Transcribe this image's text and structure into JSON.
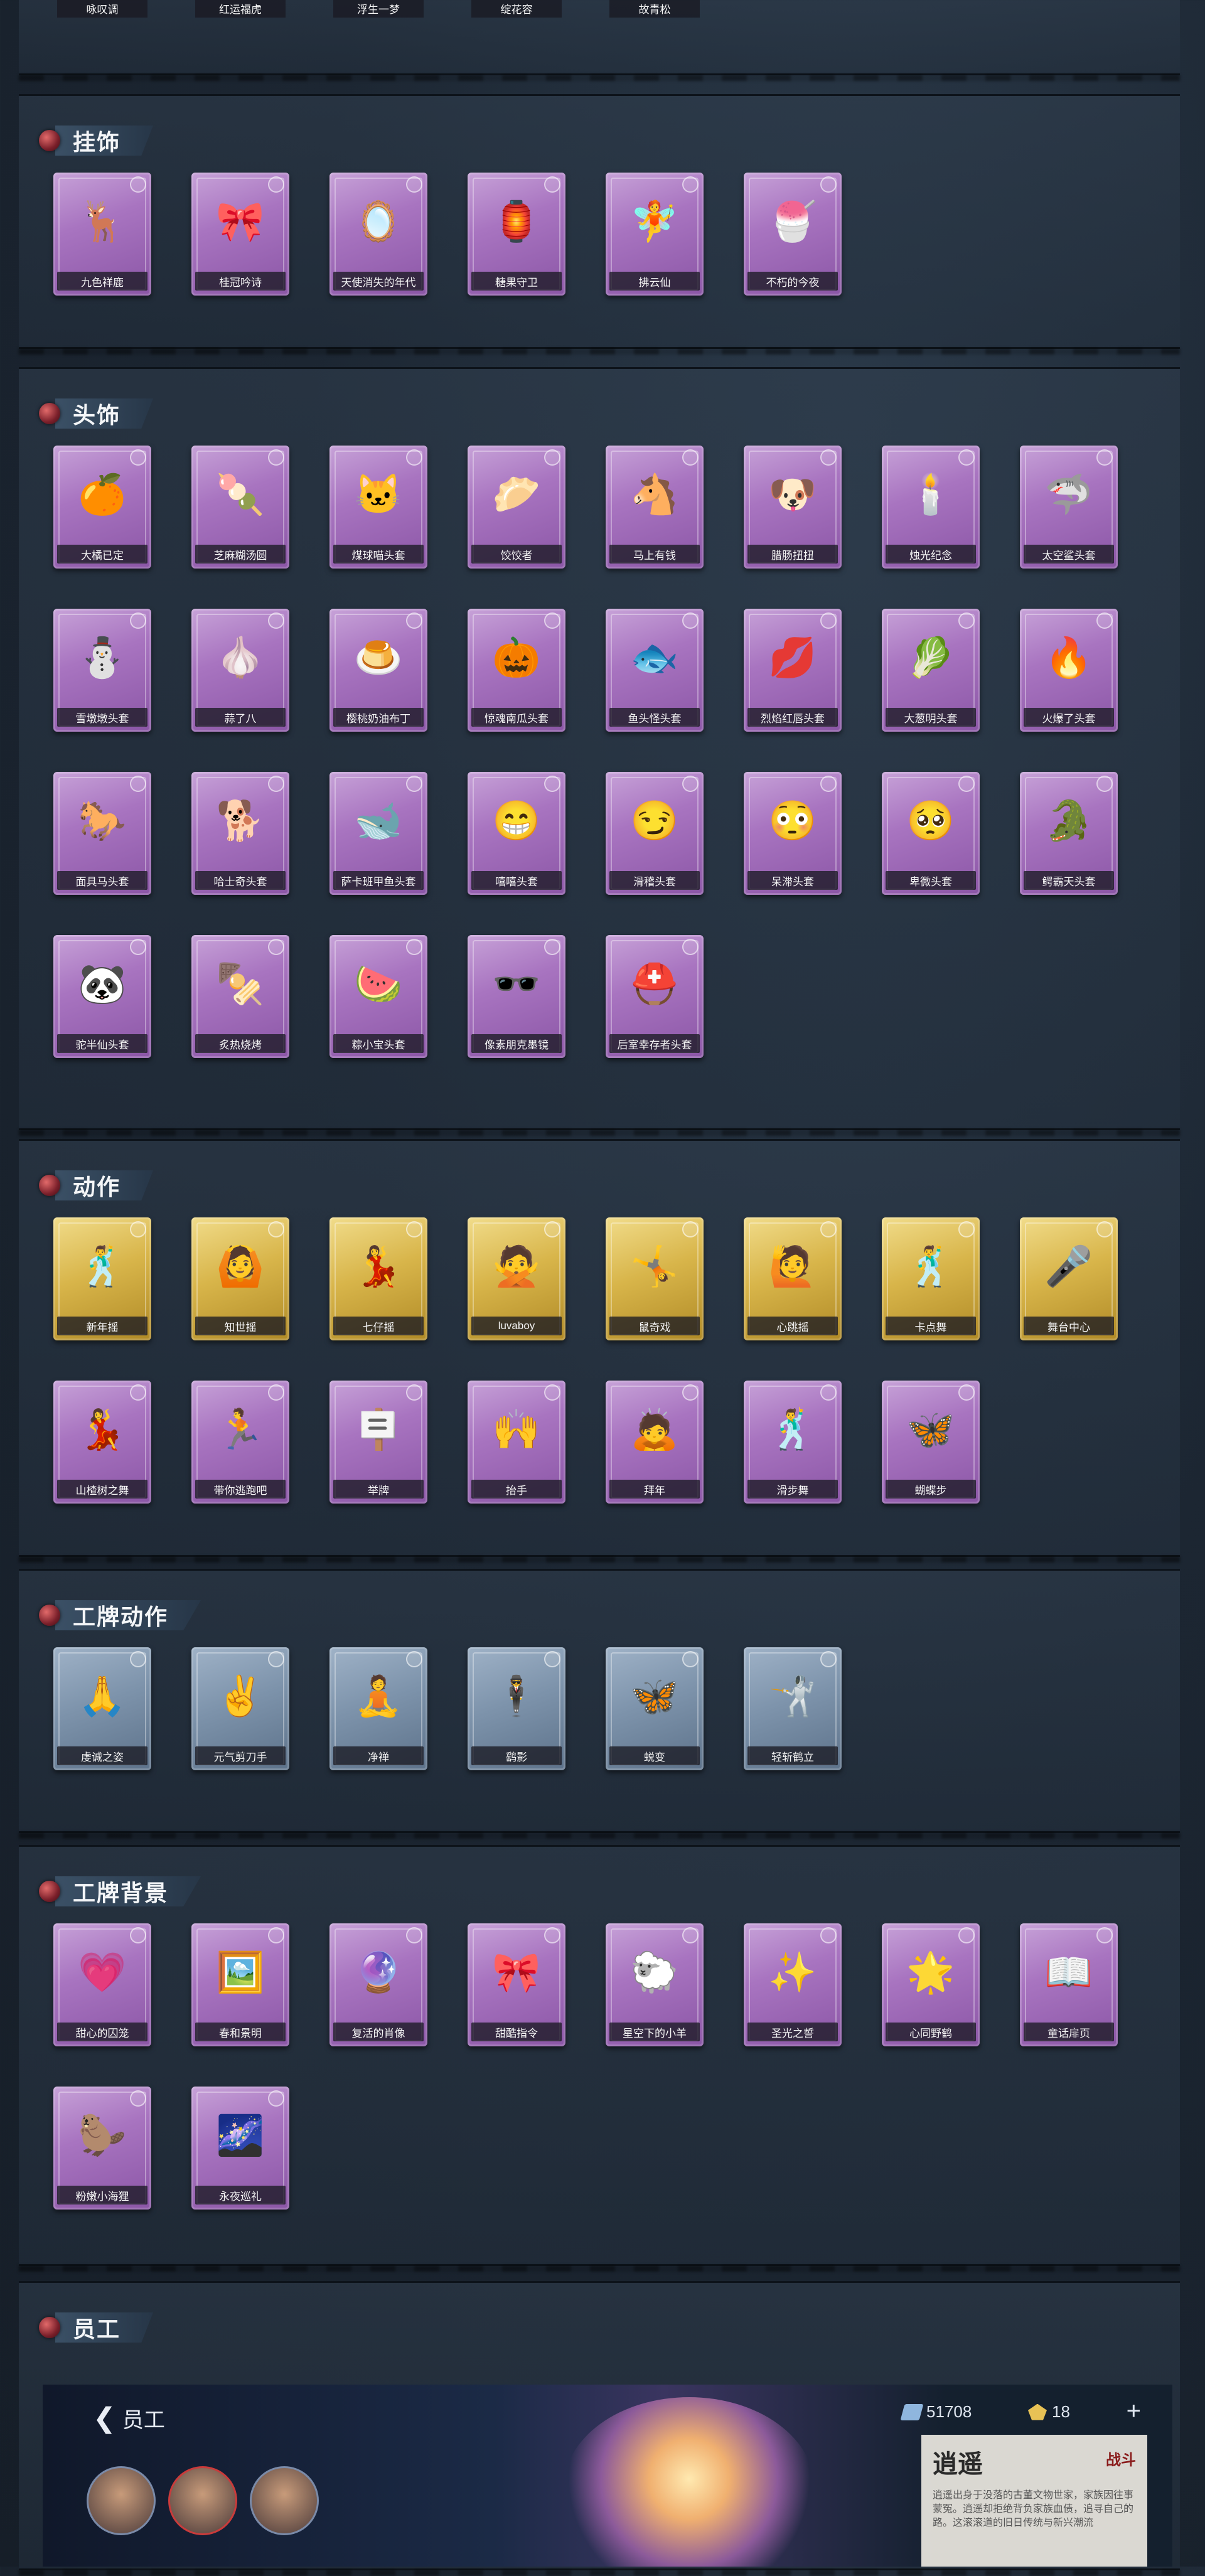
{
  "top_row": [
    "咏叹调",
    "红运福虎",
    "浮生一梦",
    "绽花容",
    "故青松"
  ],
  "sections": [
    {
      "title": "挂饰",
      "style": "purple",
      "items": [
        {
          "label": "九色祥鹿",
          "icon": "🦌"
        },
        {
          "label": "桂冠吟诗",
          "icon": "🎀"
        },
        {
          "label": "天使消失的年代",
          "icon": "🪞"
        },
        {
          "label": "糖果守卫",
          "icon": "🏮"
        },
        {
          "label": "拂云仙",
          "icon": "🧚"
        },
        {
          "label": "不朽的今夜",
          "icon": "🍧"
        }
      ]
    },
    {
      "title": "头饰",
      "style": "purple",
      "items": [
        {
          "label": "大橘已定",
          "icon": "🍊"
        },
        {
          "label": "芝麻糊汤圆",
          "icon": "🍡"
        },
        {
          "label": "煤球喵头套",
          "icon": "🐱"
        },
        {
          "label": "饺饺者",
          "icon": "🥟"
        },
        {
          "label": "马上有钱",
          "icon": "🐴"
        },
        {
          "label": "腊肠扭扭",
          "icon": "🐶"
        },
        {
          "label": "烛光纪念",
          "icon": "🕯️"
        },
        {
          "label": "太空鲨头套",
          "icon": "🦈"
        },
        {
          "label": "雪墩墩头套",
          "icon": "⛄"
        },
        {
          "label": "蒜了八",
          "icon": "🧄"
        },
        {
          "label": "樱桃奶油布丁",
          "icon": "🍮"
        },
        {
          "label": "惊魂南瓜头套",
          "icon": "🎃"
        },
        {
          "label": "鱼头怪头套",
          "icon": "🐟"
        },
        {
          "label": "烈焰红唇头套",
          "icon": "💋"
        },
        {
          "label": "大葱明头套",
          "icon": "🥬"
        },
        {
          "label": "火爆了头套",
          "icon": "🔥"
        },
        {
          "label": "面具马头套",
          "icon": "🐎"
        },
        {
          "label": "哈士奇头套",
          "icon": "🐕"
        },
        {
          "label": "萨卡班甲鱼头套",
          "icon": "🐋"
        },
        {
          "label": "嘻嘻头套",
          "icon": "😁"
        },
        {
          "label": "滑稽头套",
          "icon": "😏"
        },
        {
          "label": "呆滞头套",
          "icon": "😳"
        },
        {
          "label": "卑微头套",
          "icon": "🥺"
        },
        {
          "label": "鳄霸天头套",
          "icon": "🐊"
        },
        {
          "label": "驼半仙头套",
          "icon": "🐼"
        },
        {
          "label": "炙热烧烤",
          "icon": "🍢"
        },
        {
          "label": "粽小宝头套",
          "icon": "🍉"
        },
        {
          "label": "像素朋克墨镜",
          "icon": "🕶️"
        },
        {
          "label": "后室幸存者头套",
          "icon": "⛑️"
        }
      ]
    },
    {
      "title": "动作",
      "style": "gold",
      "items": [
        {
          "label": "新年摇",
          "icon": "🕺"
        },
        {
          "label": "知世摇",
          "icon": "🙆"
        },
        {
          "label": "七仔摇",
          "icon": "💃"
        },
        {
          "label": "luvaboy",
          "icon": "🙅"
        },
        {
          "label": "鼠奇戏",
          "icon": "🤸"
        },
        {
          "label": "心跳摇",
          "icon": "🙋"
        },
        {
          "label": "卡点舞",
          "icon": "🕺"
        },
        {
          "label": "舞台中心",
          "icon": "🎤"
        },
        {
          "label": "山楂树之舞",
          "icon": "💃",
          "style": "purple"
        },
        {
          "label": "带你逃跑吧",
          "icon": "🏃",
          "style": "purple"
        },
        {
          "label": "举牌",
          "icon": "🪧",
          "style": "purple"
        },
        {
          "label": "抬手",
          "icon": "🙌",
          "style": "purple"
        },
        {
          "label": "拜年",
          "icon": "🙇",
          "style": "purple"
        },
        {
          "label": "滑步舞",
          "icon": "🕺",
          "style": "purple"
        },
        {
          "label": "蝴蝶步",
          "icon": "🦋",
          "style": "purple"
        }
      ]
    },
    {
      "title": "工牌动作",
      "style": "blue",
      "items": [
        {
          "label": "虔诚之姿",
          "icon": "🙏"
        },
        {
          "label": "元气剪刀手",
          "icon": "✌️"
        },
        {
          "label": "净禅",
          "icon": "🧘"
        },
        {
          "label": "鹞影",
          "icon": "🕴️"
        },
        {
          "label": "蜕变",
          "icon": "🦋"
        },
        {
          "label": "轻斩鹤立",
          "icon": "🤺"
        }
      ]
    },
    {
      "title": "工牌背景",
      "style": "purple",
      "items": [
        {
          "label": "甜心的囚笼",
          "icon": "💗"
        },
        {
          "label": "春和景明",
          "icon": "🖼️"
        },
        {
          "label": "复活的肖像",
          "icon": "🔮"
        },
        {
          "label": "甜酷指令",
          "icon": "🎀"
        },
        {
          "label": "星空下的小羊",
          "icon": "🐑"
        },
        {
          "label": "圣光之誓",
          "icon": "✨"
        },
        {
          "label": "心同野鹤",
          "icon": "🌟"
        },
        {
          "label": "童话扉页",
          "icon": "📖"
        },
        {
          "label": "粉嫩小海狸",
          "icon": "🦫"
        },
        {
          "label": "永夜巡礼",
          "icon": "🌌"
        }
      ]
    },
    {
      "title": "员工",
      "style": "purple",
      "items": []
    }
  ],
  "staff": {
    "back_label": "员工",
    "currency_1": "51708",
    "currency_2": "18",
    "plus": "+",
    "name": "逍遥",
    "role": "战斗",
    "description": "逍遥出身于没落的古董文物世家，家族因往事蒙冤。逍遥却拒绝背负家族血债，追寻自己的路。这滚滚道的旧日传统与新兴潮流"
  }
}
